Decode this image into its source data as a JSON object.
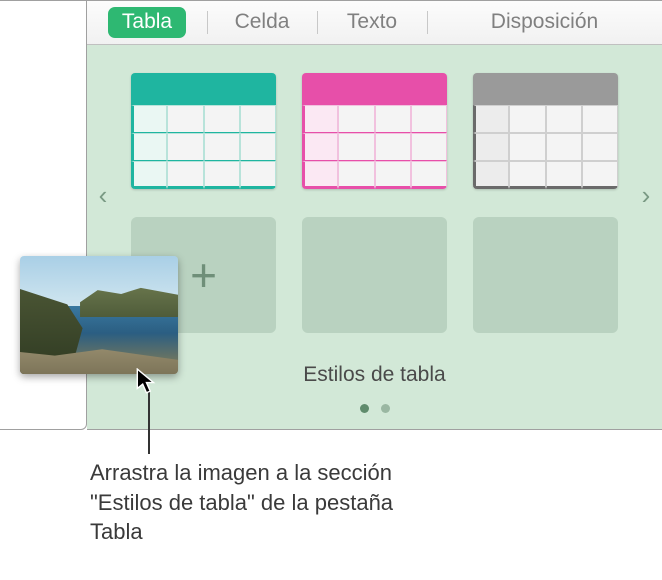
{
  "tabs": {
    "tabla": "Tabla",
    "celda": "Celda",
    "texto": "Texto",
    "disposicion": "Disposición"
  },
  "styles": {
    "label": "Estilos de tabla",
    "thumb_names": {
      "teal": "table-style-teal",
      "magenta": "table-style-magenta",
      "gray": "table-style-gray",
      "add": "add-table-style",
      "empty1": "empty-style-slot",
      "empty2": "empty-style-slot"
    },
    "add_icon": "+"
  },
  "nav": {
    "prev": "‹",
    "next": "›"
  },
  "dots": {
    "count": 2,
    "active_index": 0
  },
  "callout": {
    "text": "Arrastra la imagen a la sección \"Estilos de tabla\" de la pestaña Tabla"
  }
}
